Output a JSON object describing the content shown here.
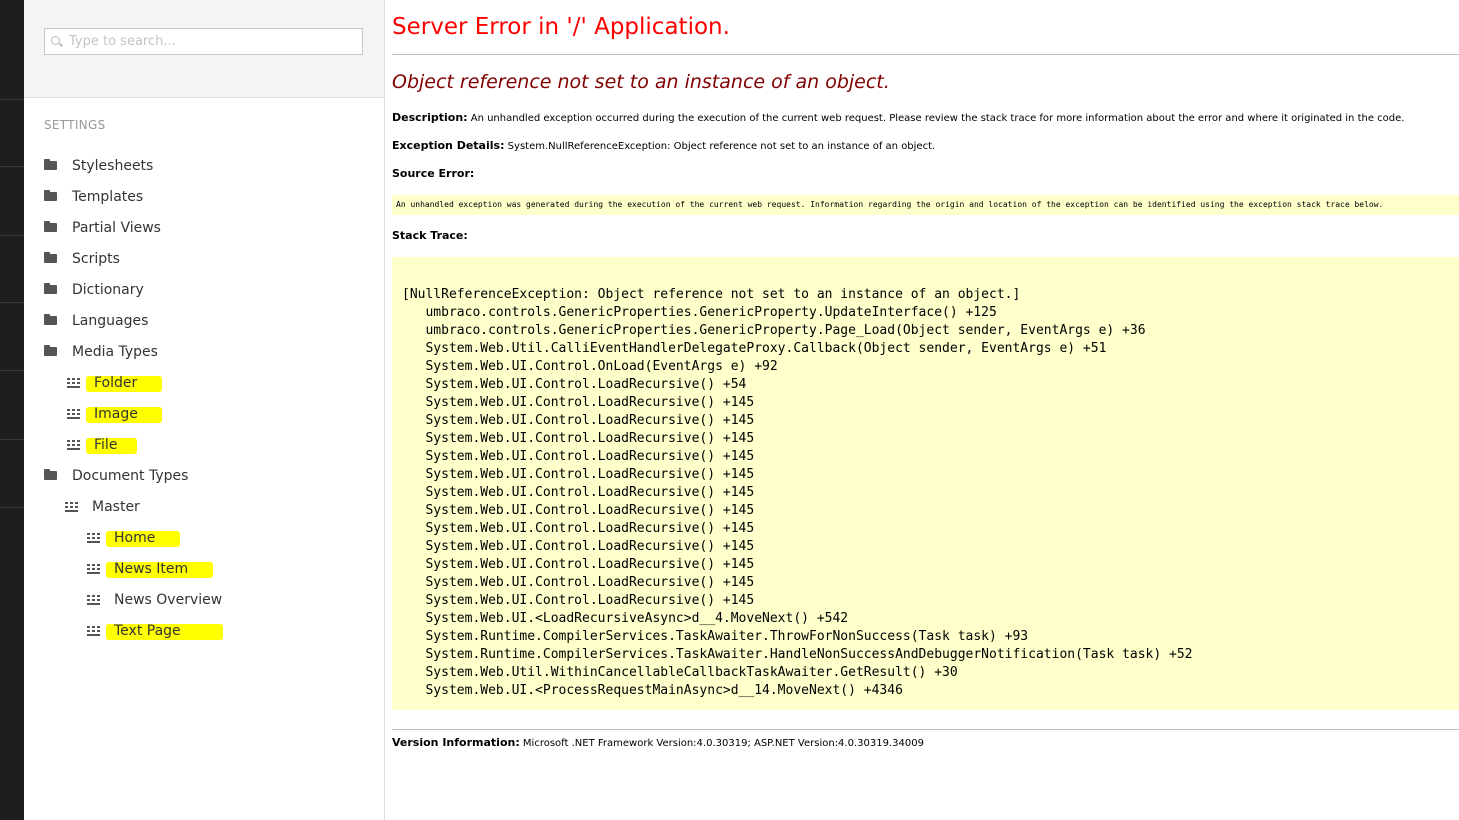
{
  "search": {
    "placeholder": "Type to search..."
  },
  "sidebar": {
    "section": "SETTINGS",
    "items": [
      {
        "label": "Stylesheets",
        "icon": "folder-icon"
      },
      {
        "label": "Templates",
        "icon": "folder-icon"
      },
      {
        "label": "Partial Views",
        "icon": "folder-icon"
      },
      {
        "label": "Scripts",
        "icon": "folder-icon"
      },
      {
        "label": "Dictionary",
        "icon": "folder-icon"
      },
      {
        "label": "Languages",
        "icon": "folder-icon"
      },
      {
        "label": "Media Types",
        "icon": "folder-icon"
      },
      {
        "label": "Folder",
        "icon": "grid-icon",
        "highlighted": true
      },
      {
        "label": "Image",
        "icon": "grid-icon",
        "highlighted": true
      },
      {
        "label": "File",
        "icon": "grid-icon",
        "highlighted": true
      },
      {
        "label": "Document Types",
        "icon": "folder-icon"
      },
      {
        "label": "Master",
        "icon": "grid-icon"
      },
      {
        "label": "Home",
        "icon": "grid-icon",
        "highlighted": true
      },
      {
        "label": "News Item",
        "icon": "grid-icon",
        "highlighted": true
      },
      {
        "label": "News Overview",
        "icon": "grid-icon"
      },
      {
        "label": "Text Page",
        "icon": "grid-icon",
        "highlighted": true
      }
    ]
  },
  "error": {
    "title": "Server Error in '/' Application.",
    "subtitle": "Object reference not set to an instance of an object.",
    "description_label": "Description:",
    "description": "An unhandled exception occurred during the execution of the current web request. Please review the stack trace for more information about the error and where it originated in the code.",
    "exception_label": "Exception Details:",
    "exception": "System.NullReferenceException: Object reference not set to an instance of an object.",
    "source_label": "Source Error:",
    "source": "An unhandled exception was generated during the execution of the current web request. Information regarding the origin and location of the exception can be identified using the exception stack trace below.",
    "stack_label": "Stack Trace:",
    "stack": [
      "[NullReferenceException: Object reference not set to an instance of an object.]",
      "   umbraco.controls.GenericProperties.GenericProperty.UpdateInterface() +125",
      "   umbraco.controls.GenericProperties.GenericProperty.Page_Load(Object sender, EventArgs e) +36",
      "   System.Web.Util.CalliEventHandlerDelegateProxy.Callback(Object sender, EventArgs e) +51",
      "   System.Web.UI.Control.OnLoad(EventArgs e) +92",
      "   System.Web.UI.Control.LoadRecursive() +54",
      "   System.Web.UI.Control.LoadRecursive() +145",
      "   System.Web.UI.Control.LoadRecursive() +145",
      "   System.Web.UI.Control.LoadRecursive() +145",
      "   System.Web.UI.Control.LoadRecursive() +145",
      "   System.Web.UI.Control.LoadRecursive() +145",
      "   System.Web.UI.Control.LoadRecursive() +145",
      "   System.Web.UI.Control.LoadRecursive() +145",
      "   System.Web.UI.Control.LoadRecursive() +145",
      "   System.Web.UI.Control.LoadRecursive() +145",
      "   System.Web.UI.Control.LoadRecursive() +145",
      "   System.Web.UI.Control.LoadRecursive() +145",
      "   System.Web.UI.Control.LoadRecursive() +145",
      "   System.Web.UI.<LoadRecursiveAsync>d__4.MoveNext() +542",
      "   System.Runtime.CompilerServices.TaskAwaiter.ThrowForNonSuccess(Task task) +93",
      "   System.Runtime.CompilerServices.TaskAwaiter.HandleNonSuccessAndDebuggerNotification(Task task) +52",
      "   System.Web.Util.WithinCancellableCallbackTaskAwaiter.GetResult() +30",
      "   System.Web.UI.<ProcessRequestMainAsync>d__14.MoveNext() +4346"
    ],
    "version_label": "Version Information:",
    "version": "Microsoft .NET Framework Version:4.0.30319; ASP.NET Version:4.0.30319.34009"
  },
  "colors": {
    "title": "#ff0000",
    "subtitle": "#800000",
    "code_background": "#ffffcc",
    "highlight": "#ffff00"
  }
}
